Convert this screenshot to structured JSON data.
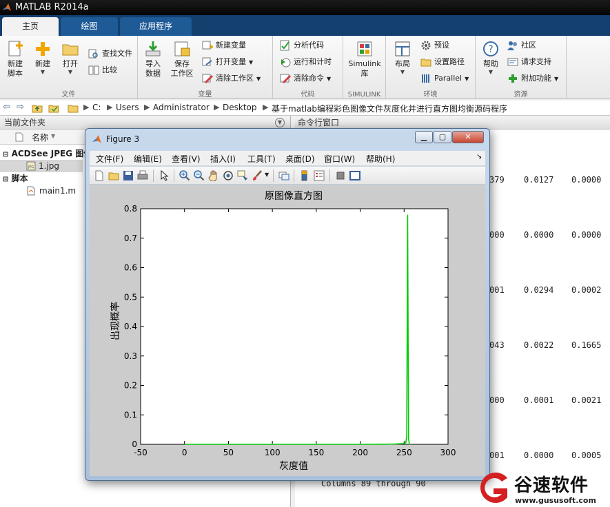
{
  "app": {
    "title": "MATLAB R2014a"
  },
  "tabs": [
    "主页",
    "绘图",
    "应用程序"
  ],
  "ribbon": {
    "file": {
      "label": "文件",
      "new_script": "新建\n脚本",
      "new": "新建",
      "open": "打开",
      "find_files": "查找文件",
      "compare": "比较"
    },
    "variable": {
      "label": "变量",
      "import": "导入\n数据",
      "save_ws": "保存\n工作区",
      "new_var": "新建变量",
      "open_var": "打开变量",
      "clear_ws": "清除工作区"
    },
    "code": {
      "label": "代码",
      "analyze": "分析代码",
      "run_time": "运行和计时",
      "clear_cmd": "清除命令"
    },
    "simulink": {
      "label": "SIMULINK",
      "btn": "Simulink\n库"
    },
    "env": {
      "label": "环境",
      "layout": "布局",
      "prefs": "预设",
      "set_path": "设置路径",
      "parallel": "Parallel"
    },
    "resources": {
      "label": "资源",
      "help": "帮助",
      "community": "社区",
      "support": "请求支持",
      "addons": "附加功能"
    }
  },
  "address": {
    "crumbs": [
      "C:",
      "Users",
      "Administrator",
      "Desktop",
      "基于matlab编程彩色图像文件灰度化并进行直方图均衡源码程序"
    ]
  },
  "current_folder": {
    "header": "当前文件夹",
    "col_name": "名称",
    "groups": [
      {
        "label": "ACDSee JPEG 图像",
        "items": [
          "1.jpg"
        ]
      },
      {
        "label": "脚本",
        "items": [
          "main1.m"
        ]
      }
    ]
  },
  "command_window": {
    "header": "命令行窗口",
    "rows": [
      [
        "379",
        "0.0127",
        "0.0000"
      ],
      [
        "000",
        "0.0000",
        "0.0000"
      ],
      [
        "001",
        "0.0294",
        "0.0002"
      ],
      [
        "043",
        "0.0022",
        "0.1665"
      ],
      [
        "000",
        "0.0001",
        "0.0021"
      ],
      [
        "001",
        "0.0000",
        "0.0005"
      ]
    ],
    "footer": "Columns 89 through 90"
  },
  "figure": {
    "title": "Figure 3",
    "menus": [
      "文件(F)",
      "编辑(E)",
      "查看(V)",
      "插入(I)",
      "工具(T)",
      "桌面(D)",
      "窗口(W)",
      "帮助(H)"
    ]
  },
  "chart_data": {
    "type": "line",
    "title": "原图像直方图",
    "xlabel": "灰度值",
    "ylabel": "出现概率",
    "xlim": [
      -50,
      300
    ],
    "ylim": [
      0,
      0.8
    ],
    "xticks": [
      -50,
      0,
      50,
      100,
      150,
      200,
      250,
      300
    ],
    "yticks": [
      0,
      0.1,
      0.2,
      0.3,
      0.4,
      0.5,
      0.6,
      0.7,
      0.8
    ],
    "color": "#00cc00",
    "x": [
      0,
      50,
      100,
      150,
      200,
      230,
      240,
      248,
      251,
      252,
      253,
      254,
      255,
      256,
      257
    ],
    "y": [
      0,
      0,
      0,
      0,
      0,
      0.0005,
      0.001,
      0.002,
      0.004,
      0.006,
      0.03,
      0.78,
      0.02,
      0,
      0
    ]
  },
  "watermark": {
    "brand": "谷速软件",
    "url": "www.gususoft.com"
  }
}
